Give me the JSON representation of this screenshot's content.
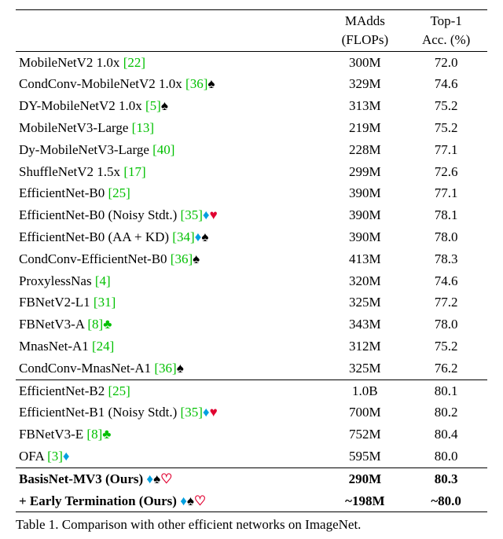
{
  "header": {
    "col0": "",
    "col1a": "MAdds",
    "col1b": "(FLOPs)",
    "col2a": "Top-1",
    "col2b": "Acc. (%)"
  },
  "group1": [
    {
      "name": "MobileNetV2 1.0x",
      "cite": "[22]",
      "icons": [],
      "madds": "300M",
      "acc": "72.0"
    },
    {
      "name": "CondConv-MobileNetV2 1.0x",
      "cite": "[36]",
      "icons": [
        "spade"
      ],
      "madds": "329M",
      "acc": "74.6"
    },
    {
      "name": "DY-MobileNetV2 1.0x",
      "cite": "[5]",
      "icons": [
        "spade"
      ],
      "madds": "313M",
      "acc": "75.2"
    },
    {
      "name": "MobileNetV3-Large",
      "cite": "[13]",
      "icons": [],
      "madds": "219M",
      "acc": "75.2"
    },
    {
      "name": "Dy-MobileNetV3-Large",
      "cite": "[40]",
      "icons": [],
      "madds": "228M",
      "acc": "77.1"
    },
    {
      "name": "ShuffleNetV2 1.5x",
      "cite": "[17]",
      "icons": [],
      "madds": "299M",
      "acc": "72.6"
    },
    {
      "name": "EfficientNet-B0",
      "cite": "[25]",
      "icons": [],
      "madds": "390M",
      "acc": "77.1"
    },
    {
      "name": "EfficientNet-B0 (Noisy Stdt.)",
      "cite": "[35]",
      "icons": [
        "diamond",
        "heart-filled"
      ],
      "madds": "390M",
      "acc": "78.1"
    },
    {
      "name": "EfficientNet-B0 (AA + KD)",
      "cite": "[34]",
      "icons": [
        "diamond",
        "spade"
      ],
      "madds": "390M",
      "acc": "78.0"
    },
    {
      "name": "CondConv-EfficientNet-B0",
      "cite": "[36]",
      "icons": [
        "spade"
      ],
      "madds": "413M",
      "acc": "78.3"
    },
    {
      "name": "ProxylessNas",
      "cite": "[4]",
      "icons": [],
      "madds": "320M",
      "acc": "74.6"
    },
    {
      "name": "FBNetV2-L1",
      "cite": "[31]",
      "icons": [],
      "madds": "325M",
      "acc": "77.2"
    },
    {
      "name": "FBNetV3-A",
      "cite": "[8]",
      "icons": [
        "club"
      ],
      "madds": "343M",
      "acc": "78.0"
    },
    {
      "name": "MnasNet-A1",
      "cite": "[24]",
      "icons": [],
      "madds": "312M",
      "acc": "75.2"
    },
    {
      "name": "CondConv-MnasNet-A1",
      "cite": "[36]",
      "icons": [
        "spade"
      ],
      "madds": "325M",
      "acc": "76.2"
    }
  ],
  "group2": [
    {
      "name": "EfficientNet-B2",
      "cite": "[25]",
      "icons": [],
      "madds": "1.0B",
      "acc": "80.1"
    },
    {
      "name": "EfficientNet-B1 (Noisy Stdt.)",
      "cite": "[35]",
      "icons": [
        "diamond",
        "heart-filled"
      ],
      "madds": "700M",
      "acc": "80.2"
    },
    {
      "name": "FBNetV3-E",
      "cite": "[8]",
      "icons": [
        "club"
      ],
      "madds": "752M",
      "acc": "80.4"
    },
    {
      "name": "OFA",
      "cite": "[3]",
      "icons": [
        "diamond"
      ],
      "madds": "595M",
      "acc": "80.0"
    }
  ],
  "group3": [
    {
      "name": "BasisNet-MV3 (Ours)",
      "cite": "",
      "icons": [
        "diamond",
        "spade",
        "heart-outline"
      ],
      "madds": "290M",
      "acc": "80.3",
      "bold": true
    },
    {
      "name": "+ Early Termination (Ours)",
      "cite": "",
      "icons": [
        "diamond",
        "spade",
        "heart-outline"
      ],
      "madds": "~198M",
      "acc": "~80.0",
      "bold": true
    }
  ],
  "caption": "Table 1. Comparison with other efficient networks on ImageNet."
}
